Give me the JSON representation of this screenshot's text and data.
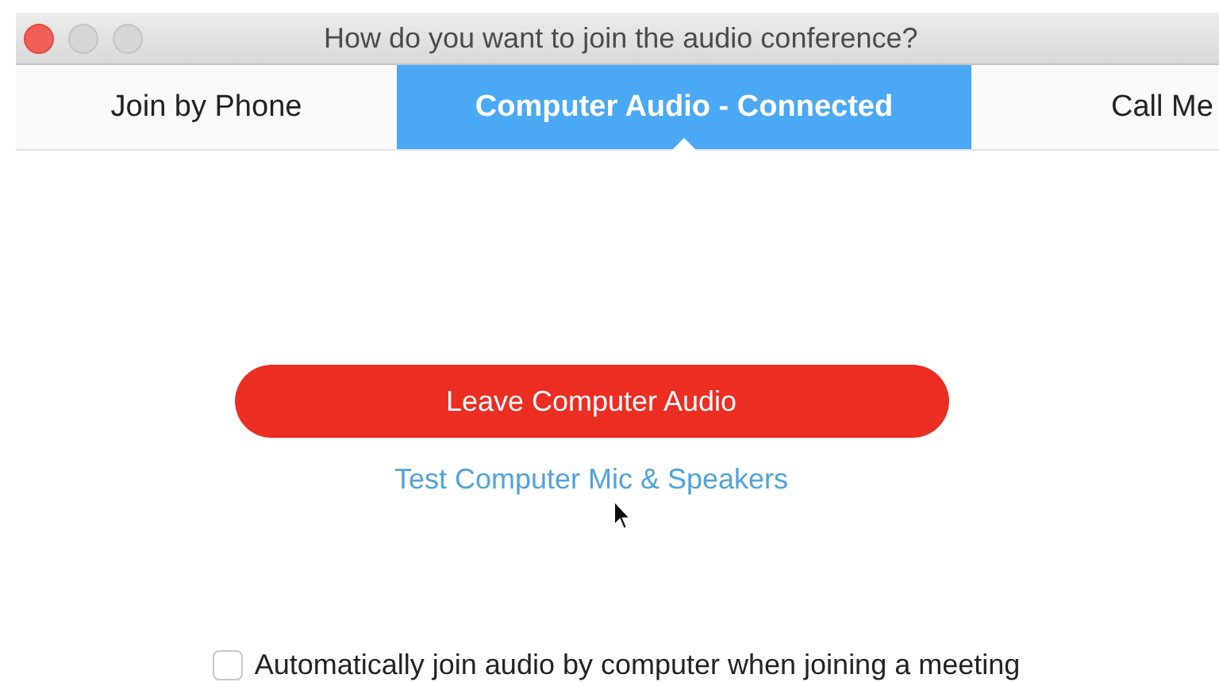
{
  "window": {
    "title": "How do you want to join the audio conference?"
  },
  "tabs": [
    {
      "label": "Join by Phone",
      "selected": false
    },
    {
      "label": "Computer Audio - Connected",
      "selected": true
    },
    {
      "label": "Call Me",
      "selected": false
    }
  ],
  "leave_button": {
    "label": "Leave Computer Audio"
  },
  "test_link": {
    "label": "Test Computer Mic & Speakers"
  },
  "auto_join": {
    "label": "Automatically join audio by computer when joining a meeting",
    "checked": false
  }
}
